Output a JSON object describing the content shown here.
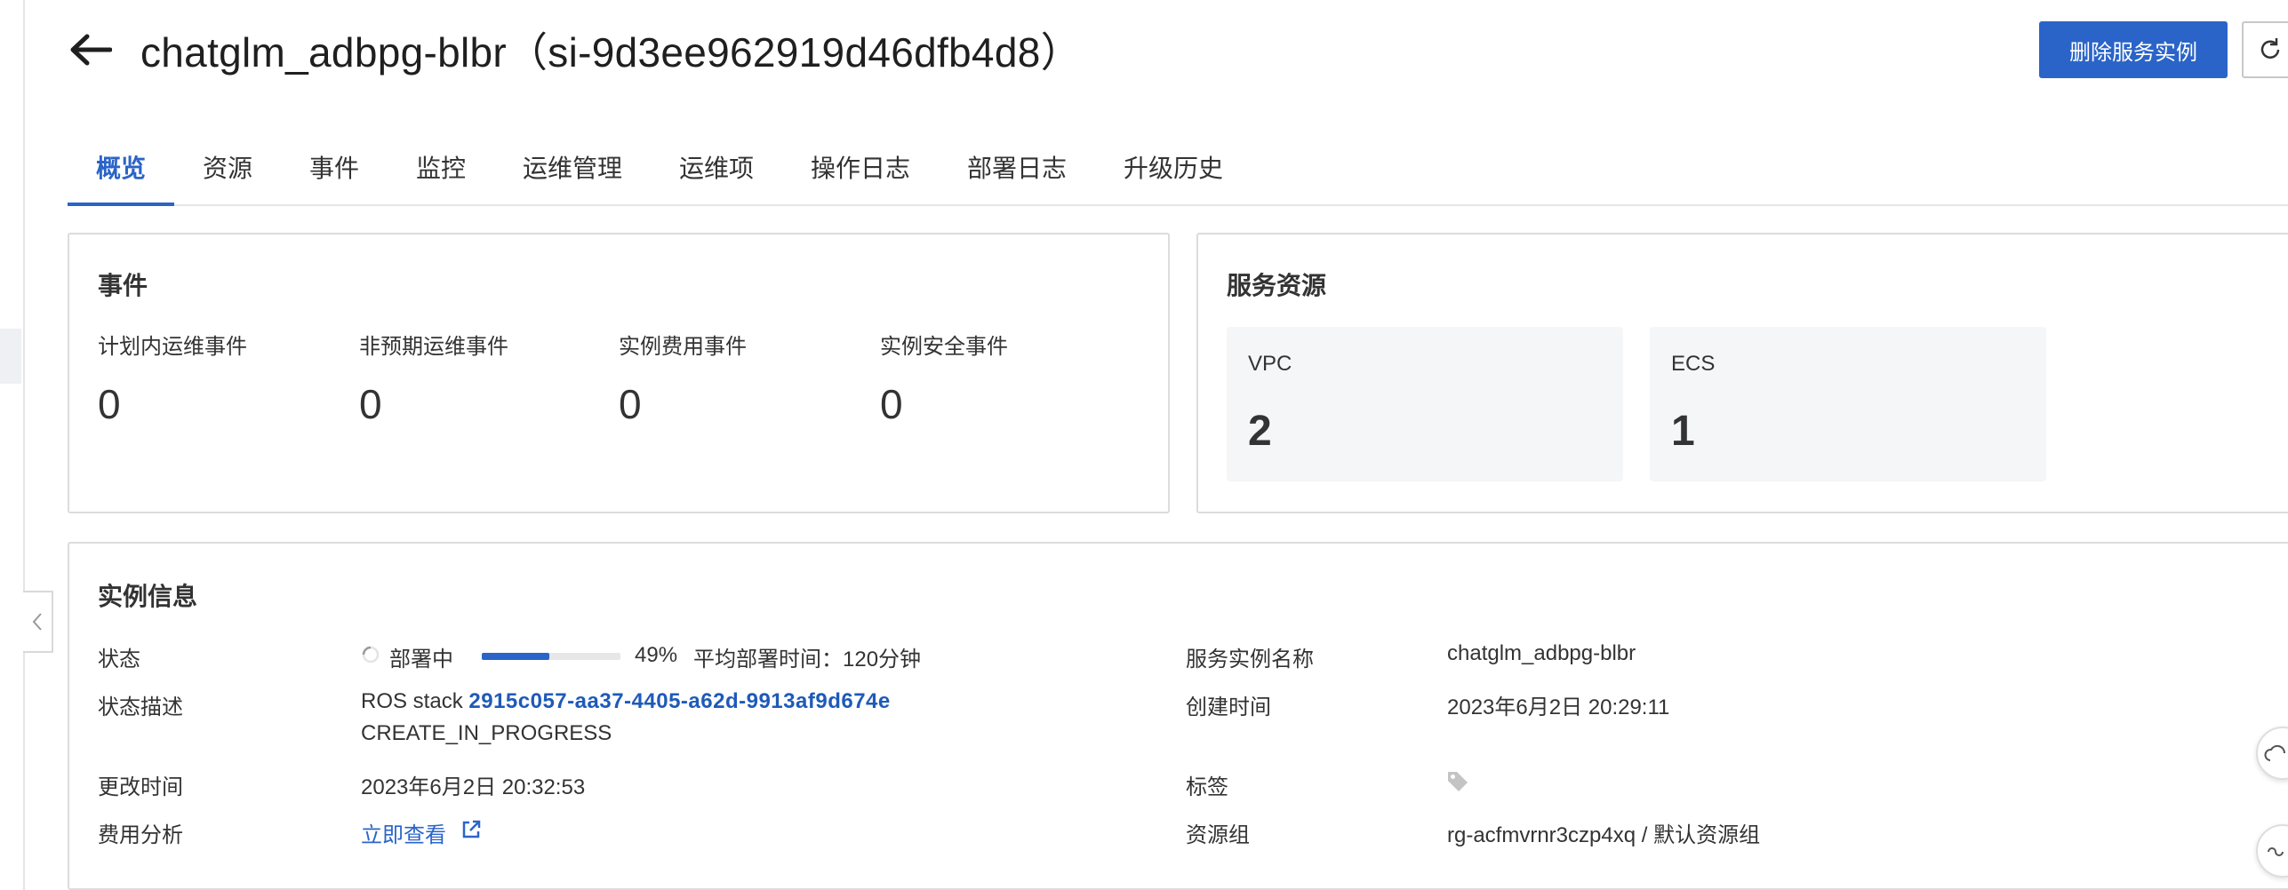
{
  "header": {
    "title": "chatglm_adbpg-blbr（si-9d3ee962919d46dfb4d8）",
    "delete_label": "删除服务实例"
  },
  "tabs": [
    {
      "label": "概览",
      "active": true
    },
    {
      "label": "资源"
    },
    {
      "label": "事件"
    },
    {
      "label": "监控"
    },
    {
      "label": "运维管理"
    },
    {
      "label": "运维项"
    },
    {
      "label": "操作日志"
    },
    {
      "label": "部署日志"
    },
    {
      "label": "升级历史"
    }
  ],
  "events": {
    "title": "事件",
    "items": [
      {
        "label": "计划内运维事件",
        "value": "0"
      },
      {
        "label": "非预期运维事件",
        "value": "0"
      },
      {
        "label": "实例费用事件",
        "value": "0"
      },
      {
        "label": "实例安全事件",
        "value": "0"
      }
    ]
  },
  "resources": {
    "title": "服务资源",
    "items": [
      {
        "label": "VPC",
        "value": "2"
      },
      {
        "label": "ECS",
        "value": "1"
      }
    ]
  },
  "instance": {
    "title": "实例信息",
    "status_label": "状态",
    "status_value": "部署中",
    "progress_percent": 49,
    "progress_text": "49%",
    "avg_deploy": "平均部署时间：120分钟",
    "status_desc_label": "状态描述",
    "ros_prefix": "ROS stack",
    "stack_id": "2915c057-aa37-4405-a62d-9913af9d674e",
    "stack_state": "CREATE_IN_PROGRESS",
    "modified_label": "更改时间",
    "modified_value": "2023年6月2日 20:32:53",
    "cost_label": "费用分析",
    "cost_link": "立即查看",
    "name_label": "服务实例名称",
    "name_value": "chatglm_adbpg-blbr",
    "created_label": "创建时间",
    "created_value": "2023年6月2日 20:29:11",
    "tags_label": "标签",
    "resgroup_label": "资源组",
    "resgroup_value": "rg-acfmvrnr3czp4xq / 默认资源组"
  },
  "colors": {
    "accent": "#2b64c8",
    "text": "#333333",
    "border": "#dcdcdc",
    "resource_bg": "#f5f6f8"
  }
}
